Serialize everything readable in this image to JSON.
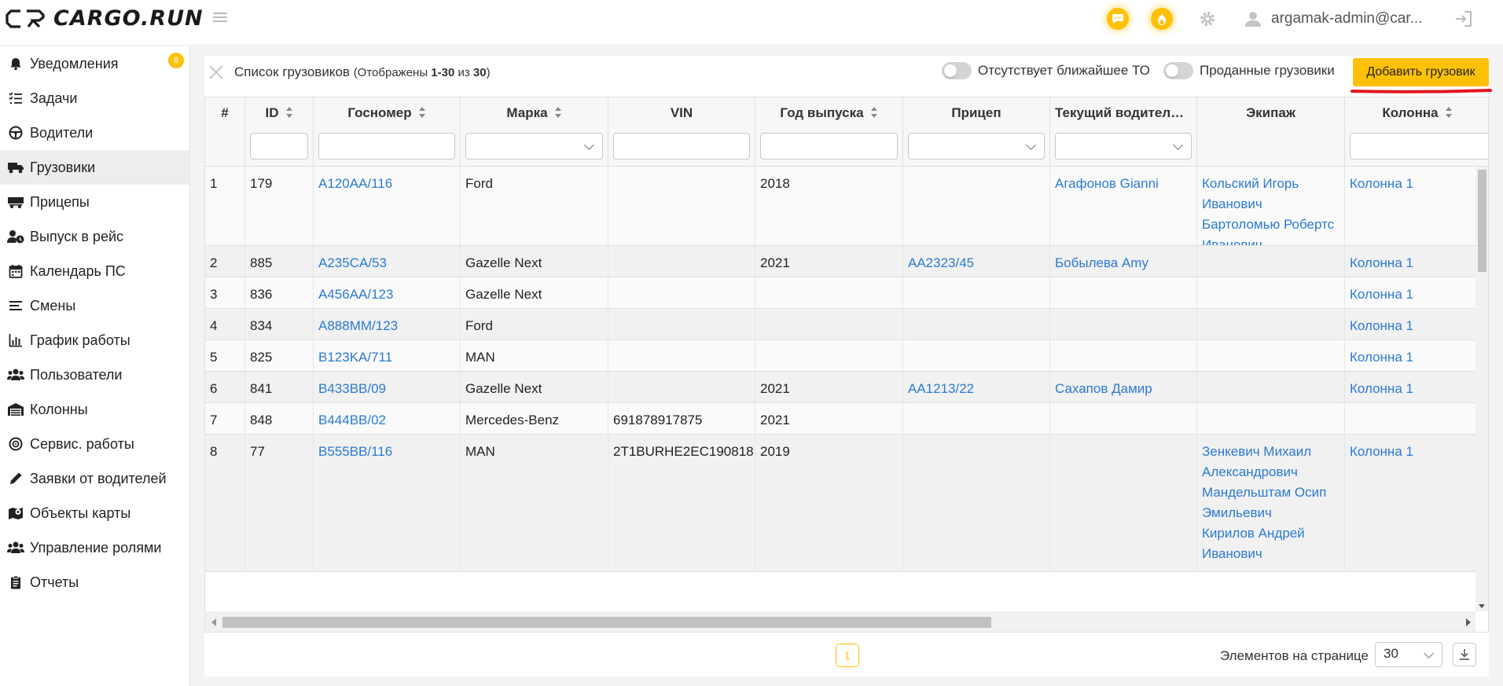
{
  "header": {
    "logo_text": "CARGO.RUN",
    "user_name": "argamak-admin@car...",
    "colors": {
      "accent": "#ffc107",
      "link": "#2a7ad3"
    }
  },
  "sidebar": {
    "notifications_badge": "8",
    "items": [
      {
        "label": "Уведомления",
        "icon": "bell-icon"
      },
      {
        "label": "Задачи",
        "icon": "task-list-icon"
      },
      {
        "label": "Водители",
        "icon": "steering-wheel-icon"
      },
      {
        "label": "Грузовики",
        "icon": "truck-icon",
        "active": true
      },
      {
        "label": "Прицепы",
        "icon": "trailer-icon"
      },
      {
        "label": "Выпуск в рейс",
        "icon": "user-clock-icon"
      },
      {
        "label": "Календарь ПС",
        "icon": "calendar-icon"
      },
      {
        "label": "Смены",
        "icon": "lines-icon"
      },
      {
        "label": "График работы",
        "icon": "bar-chart-icon"
      },
      {
        "label": "Пользователи",
        "icon": "users-icon"
      },
      {
        "label": "Колонны",
        "icon": "warehouse-icon"
      },
      {
        "label": "Сервис. работы",
        "icon": "tire-icon"
      },
      {
        "label": "Заявки от водителей",
        "icon": "pen-icon"
      },
      {
        "label": "Объекты карты",
        "icon": "map-icon"
      },
      {
        "label": "Управление ролями",
        "icon": "users-cog-icon"
      },
      {
        "label": "Отчеты",
        "icon": "clipboard-icon"
      }
    ]
  },
  "toolbar": {
    "title": "Список грузовиков",
    "shown_prefix": "(Отображены ",
    "shown_range": "1-30",
    "shown_of": " из ",
    "shown_total": "30",
    "shown_suffix": ")",
    "toggle_no_maintenance": "Отсутствует ближайшее ТО",
    "toggle_sold": "Проданные грузовики",
    "add_button": "Добавить грузовик"
  },
  "table": {
    "columns": {
      "num": "#",
      "id": "ID",
      "plate": "Госномер",
      "brand": "Марка",
      "vin": "VIN",
      "year": "Год выпуска",
      "trailer": "Прицеп",
      "driver": "Текущий водитель(...",
      "crew": "Экипаж",
      "column": "Колонна"
    },
    "rows": [
      {
        "num": "1",
        "id": "179",
        "plate": "A120AA/116",
        "brand": "Ford",
        "vin": "",
        "year": "2018",
        "trailer": "",
        "driver": "Агафонов Gianni",
        "crew": [
          "Кольский Игорь",
          "Иванович",
          "Бартоломью Робертс",
          "Иванович"
        ],
        "column": "Колонна 1"
      },
      {
        "num": "2",
        "id": "885",
        "plate": "A235CA/53",
        "brand": "Gazelle Next",
        "vin": "",
        "year": "2021",
        "trailer": "AA2323/45",
        "driver": "Бобылева Amy",
        "crew": [],
        "column": "Колонна 1"
      },
      {
        "num": "3",
        "id": "836",
        "plate": "A456AA/123",
        "brand": "Gazelle Next",
        "vin": "",
        "year": "",
        "trailer": "",
        "driver": "",
        "crew": [],
        "column": "Колонна 1"
      },
      {
        "num": "4",
        "id": "834",
        "plate": "A888MM/123",
        "brand": "Ford",
        "vin": "",
        "year": "",
        "trailer": "",
        "driver": "",
        "crew": [],
        "column": "Колонна 1"
      },
      {
        "num": "5",
        "id": "825",
        "plate": "B123KA/711",
        "brand": "MAN",
        "vin": "",
        "year": "",
        "trailer": "",
        "driver": "",
        "crew": [],
        "column": "Колонна 1"
      },
      {
        "num": "6",
        "id": "841",
        "plate": "B433BB/09",
        "brand": "Gazelle Next",
        "vin": "",
        "year": "2021",
        "trailer": "AA1213/22",
        "driver": "Сахапов Дамир",
        "crew": [],
        "column": "Колонна 1"
      },
      {
        "num": "7",
        "id": "848",
        "plate": "B444BB/02",
        "brand": "Mercedes-Benz",
        "vin": "691878917875",
        "year": "2021",
        "trailer": "",
        "driver": "",
        "crew": [],
        "column": ""
      },
      {
        "num": "8",
        "id": "77",
        "plate": "B555BB/116",
        "brand": "MAN",
        "vin": "2T1BURHE2EC190818",
        "year": "2019",
        "trailer": "",
        "driver": "",
        "crew": [
          "Зенкевич Михаил",
          "Александрович",
          "Мандельштам Осип",
          "Эмильевич",
          "Кирилов Андрей",
          "Иванович"
        ],
        "column": "Колонна 1"
      }
    ]
  },
  "pager": {
    "current_page": "1",
    "per_page_label": "Элементов на странице",
    "per_page_value": "30"
  }
}
